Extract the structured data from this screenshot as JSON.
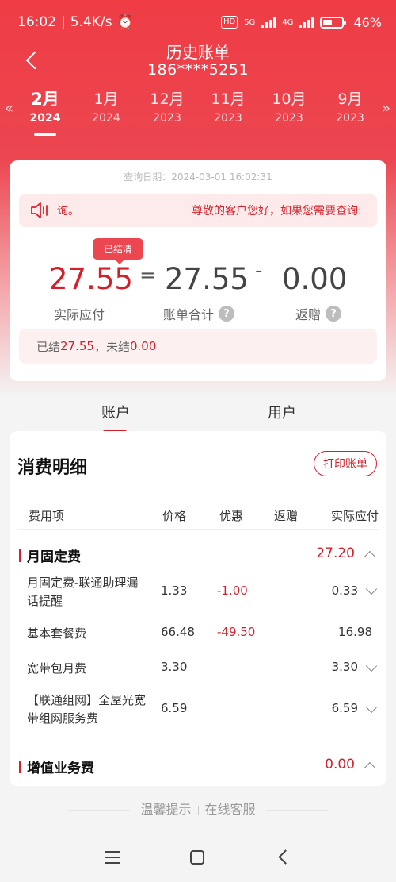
{
  "status": {
    "time": "16:02",
    "speed": "5.4K/s",
    "hd": "HD",
    "net1": "5G",
    "net2": "4G",
    "battery": "46%"
  },
  "header": {
    "title": "历史账单",
    "phone": "186****5251"
  },
  "months": [
    {
      "m": "2月",
      "y": "2024"
    },
    {
      "m": "1月",
      "y": "2024"
    },
    {
      "m": "12月",
      "y": "2023"
    },
    {
      "m": "11月",
      "y": "2023"
    },
    {
      "m": "10月",
      "y": "2023"
    },
    {
      "m": "9月",
      "y": "2023"
    }
  ],
  "summary": {
    "query_date": "查询日期：2024-03-01 16:02:31",
    "notice_left": "询。",
    "notice_right": "尊敬的客户您好，如果您需要查询:",
    "badge": "已结清",
    "actual": "27.55",
    "eq": "=",
    "total": "27.55",
    "minus": "-",
    "refund": "0.00",
    "actual_label": "实际应付",
    "total_label": "账单合计",
    "refund_label": "返赠",
    "help": "?",
    "settled_prefix": "已结",
    "settled_value": "27.55",
    "unsettled_prefix": "，未结",
    "unsettled_value": "0.00"
  },
  "tabs": {
    "account": "账户",
    "user": "用户"
  },
  "detail": {
    "title": "消费明细",
    "print": "打印账单",
    "cols": {
      "item": "费用项",
      "price": "价格",
      "discount": "优惠",
      "refund": "返赠",
      "actual": "实际应付"
    },
    "sec1": {
      "name": "月固定费",
      "total": "27.20"
    },
    "rows": [
      {
        "name": "月固定费-联通助理漏话提醒",
        "price": "1.33",
        "discount": "-1.00",
        "actual": "0.33"
      },
      {
        "name": "基本套餐费",
        "price": "66.48",
        "discount": "-49.50",
        "actual": "16.98"
      },
      {
        "name": "宽带包月费",
        "price": "3.30",
        "discount": "",
        "actual": "3.30"
      },
      {
        "name": "【联通组网】全屋光宽带组网服务费",
        "price": "6.59",
        "discount": "",
        "actual": "6.59"
      }
    ],
    "sec2": {
      "name": "增值业务费",
      "total": "0.00"
    }
  },
  "footer": {
    "tip": "温馨提示",
    "service": "在线客服"
  }
}
